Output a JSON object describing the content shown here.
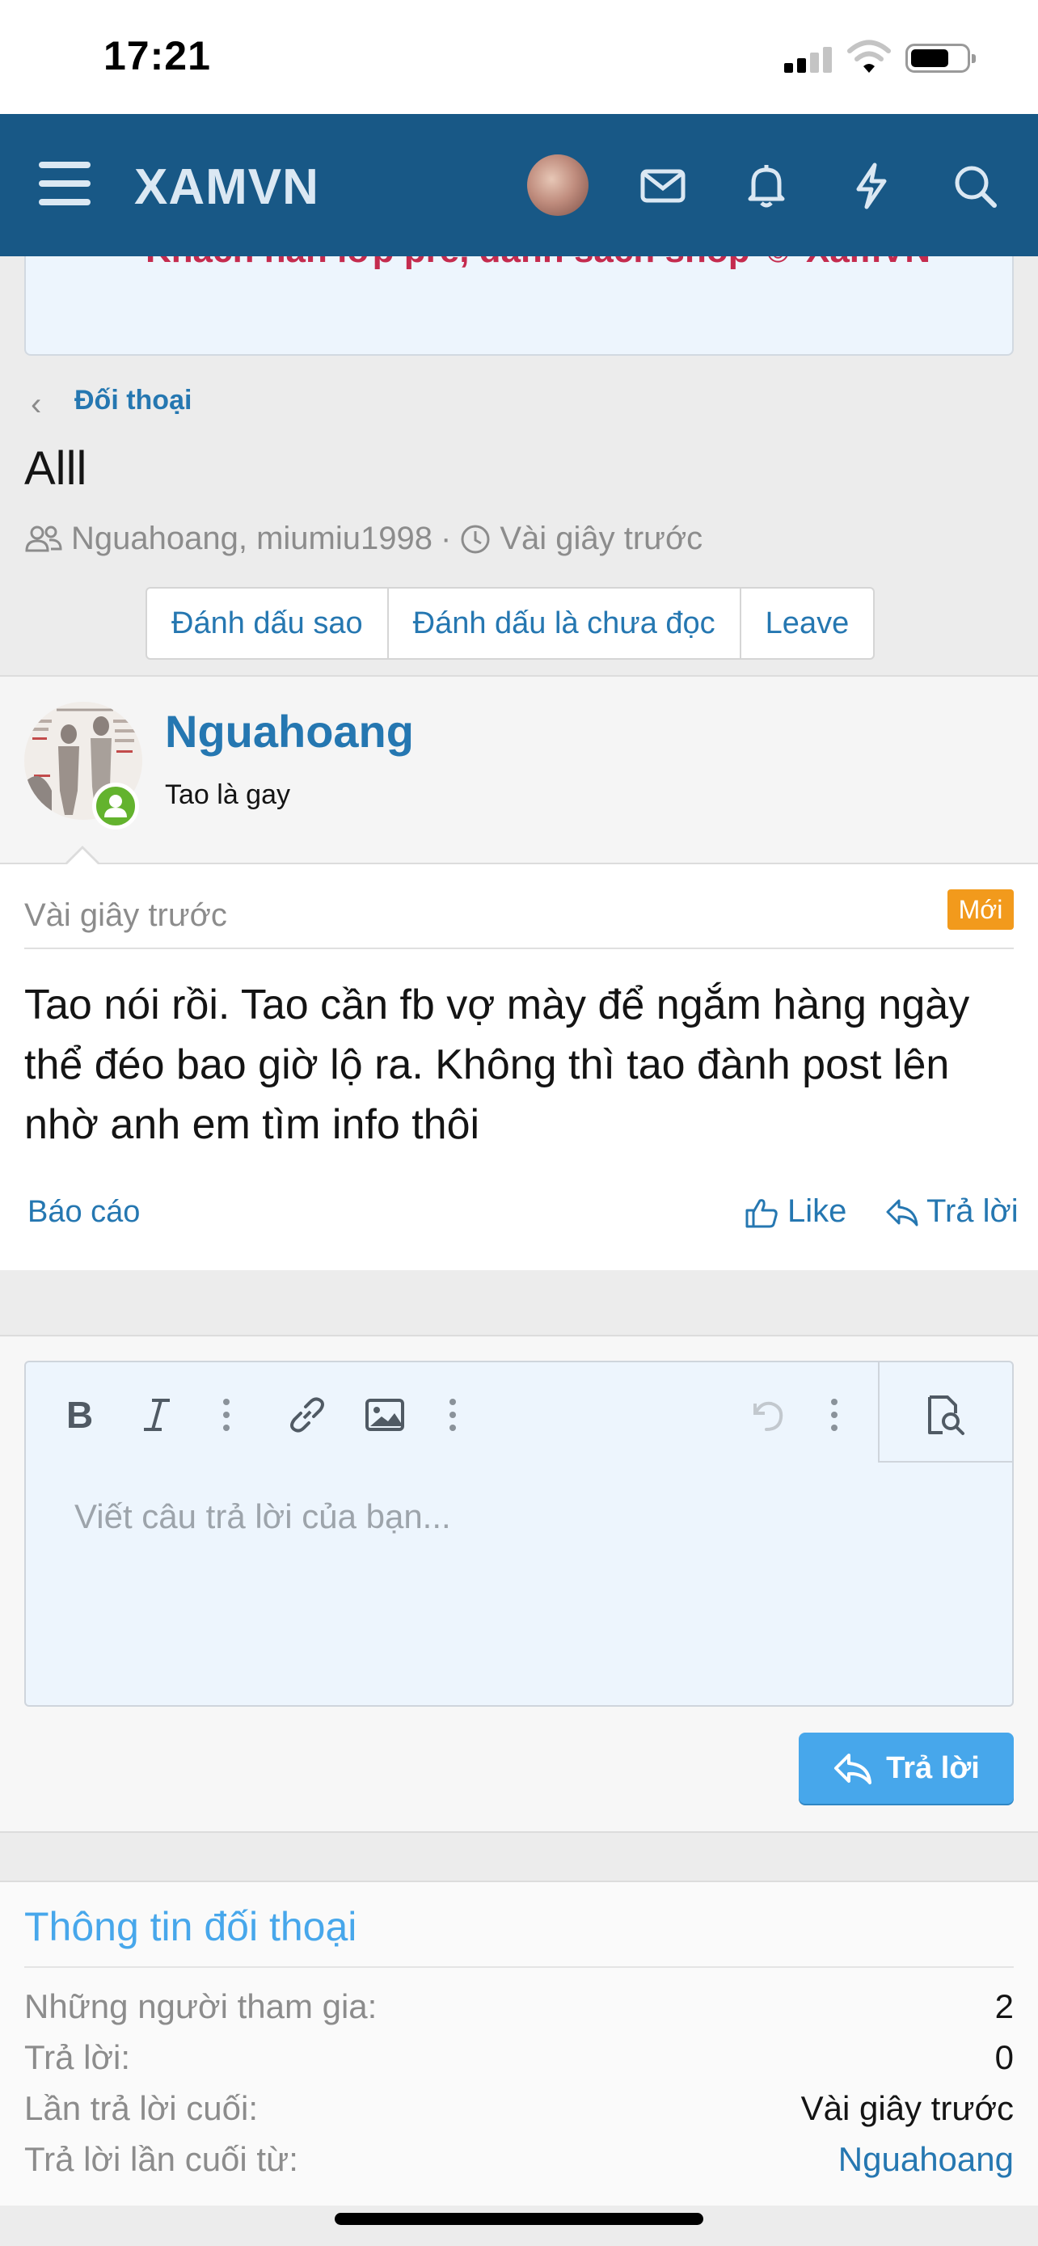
{
  "status_bar": {
    "time": "17:21"
  },
  "header": {
    "logo": "XAMVN"
  },
  "banner": {
    "text": "Khách hàn lớp pre, danh sách shop ☺ XamVN"
  },
  "breadcrumb": {
    "label": "Đối thoại"
  },
  "conversation": {
    "title": "Alll",
    "participants": "Nguahoang, miumiu1998",
    "separator": "·",
    "time": "Vài giây trước",
    "actions": [
      "Đánh dấu sao",
      "Đánh dấu là chưa đọc",
      "Leave"
    ]
  },
  "message": {
    "username": "Nguahoang",
    "user_title": "Tao là gay",
    "date": "Vài giây trước",
    "badge": "Mới",
    "text": "Tao nói rồi. Tao cần fb vợ mày để ngắm hàng ngày thể đéo bao giờ lộ ra. Không thì tao đành post lên nhờ anh em tìm info thôi",
    "report": "Báo cáo",
    "like": "Like",
    "reply": "Trả lời"
  },
  "editor": {
    "placeholder": "Viết câu trả lời của bạn...",
    "submit": "Trả lời"
  },
  "info": {
    "title": "Thông tin đối thoại",
    "rows": [
      {
        "label": "Những người tham gia:",
        "value": "2"
      },
      {
        "label": "Trả lời:",
        "value": "0"
      },
      {
        "label": "Lần trả lời cuối:",
        "value": "Vài giây trước"
      },
      {
        "label": "Trả lời lần cuối từ:",
        "value": "Nguahoang"
      }
    ]
  },
  "colors": {
    "header_bg": "#185886",
    "link": "#2577b1",
    "accent_blue": "#47a7eb",
    "badge_orange": "#f29a1c",
    "online_green": "#63b32e"
  }
}
